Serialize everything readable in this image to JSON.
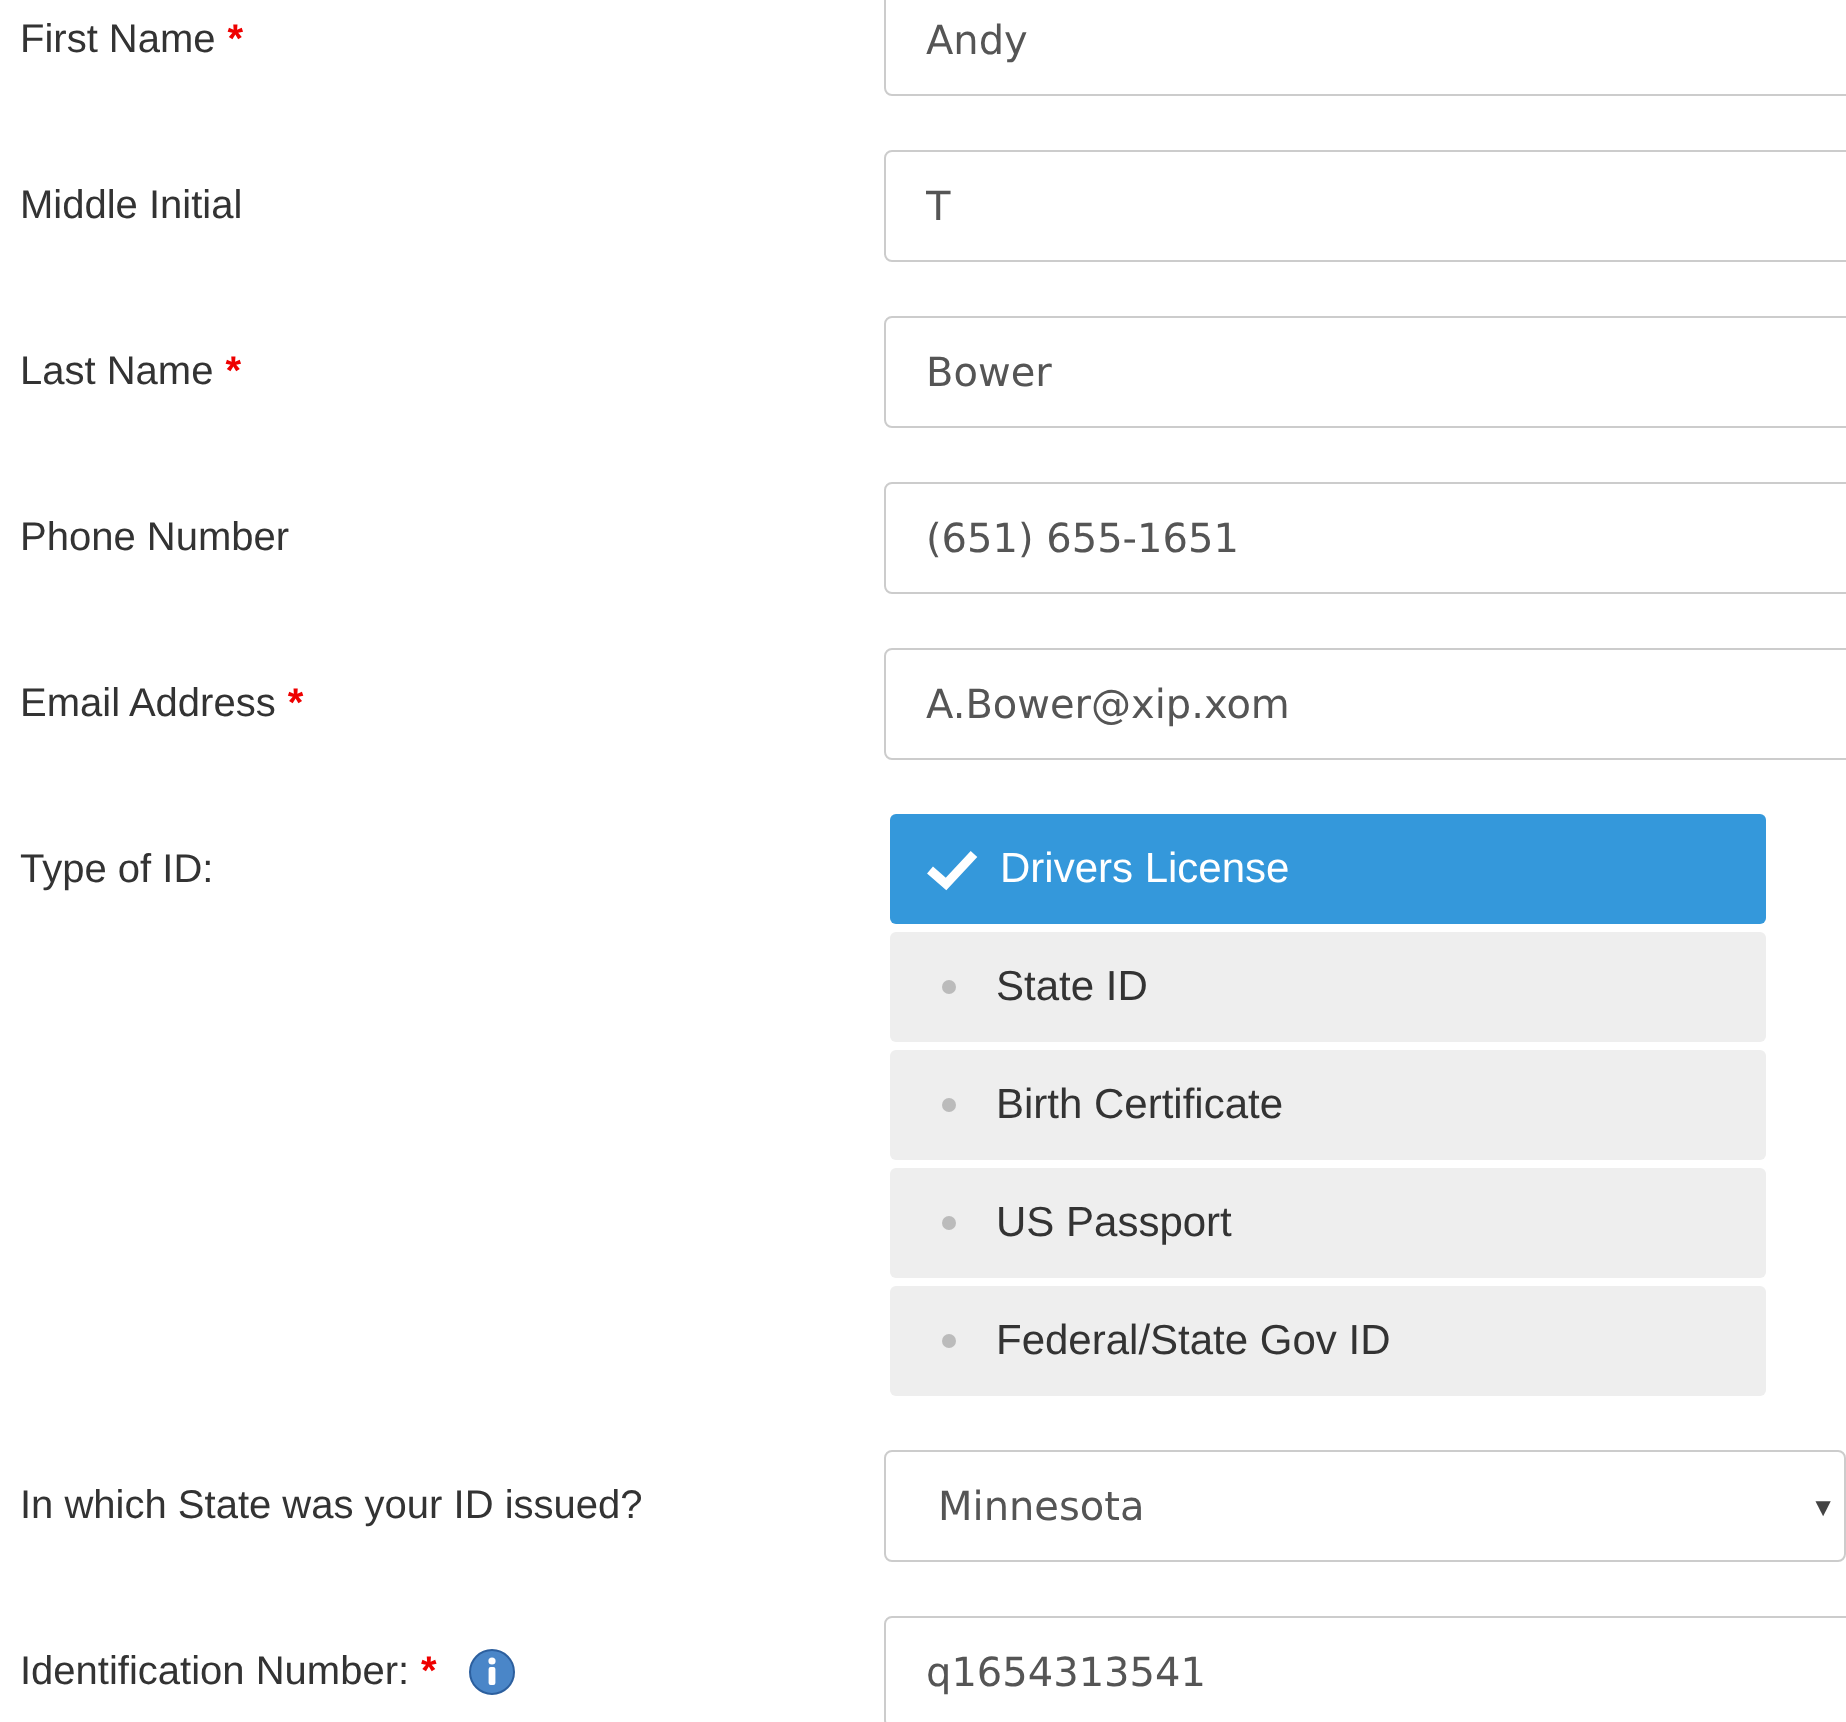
{
  "fields": [
    {
      "kind": "text",
      "label": "First Name",
      "required_mark": "*",
      "value": "Andy"
    },
    {
      "kind": "text",
      "label": "Middle Initial",
      "value": "T"
    },
    {
      "kind": "text",
      "label": "Last Name",
      "required_mark": "*",
      "value": "Bower"
    },
    {
      "kind": "text",
      "label": "Phone Number",
      "value": "(651) 655-1651"
    },
    {
      "kind": "text",
      "label": "Email Address",
      "required_mark": "*",
      "value": "A.Bower@xip.xom"
    },
    {
      "kind": "choice",
      "label": "Type of ID:",
      "options": [
        {
          "label": "Drivers License",
          "selected": true
        },
        {
          "label": "State ID",
          "selected": false
        },
        {
          "label": "Birth Certificate",
          "selected": false
        },
        {
          "label": "US Passport",
          "selected": false
        },
        {
          "label": "Federal/State Gov ID",
          "selected": false
        }
      ]
    },
    {
      "kind": "select",
      "label": "In which State was your ID issued?",
      "value": "Minnesota",
      "arrow": "▼"
    },
    {
      "kind": "text",
      "label": "Identification Number:",
      "required_mark": "*",
      "info": true,
      "value": "q1654313541"
    }
  ]
}
